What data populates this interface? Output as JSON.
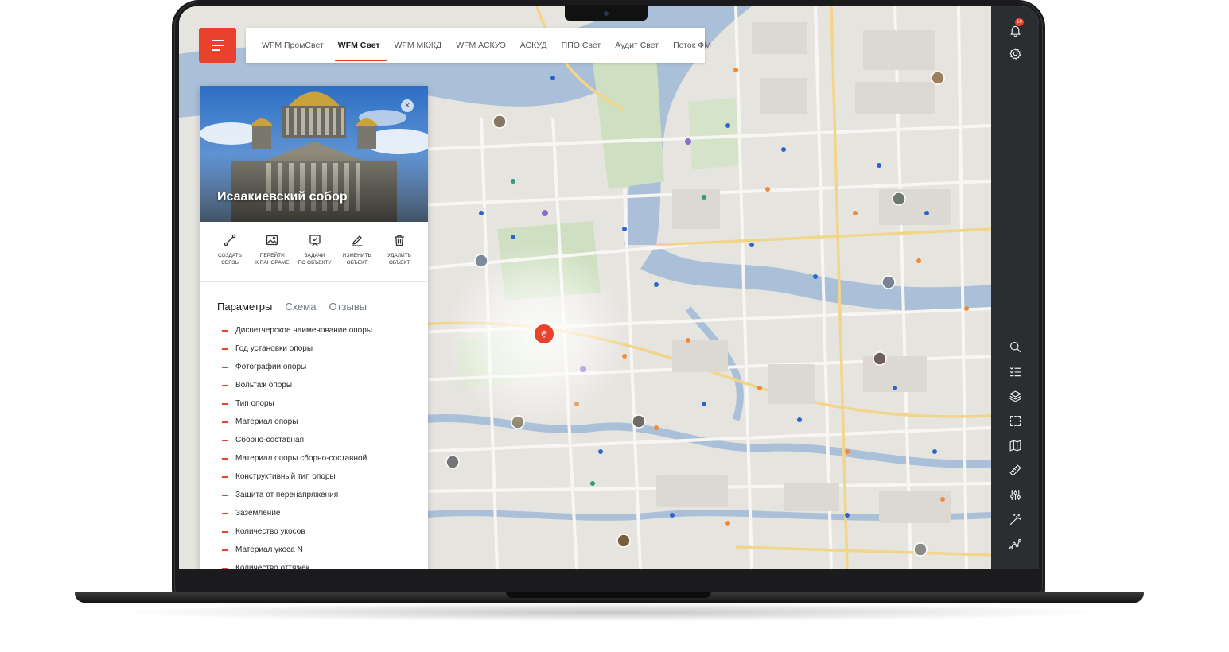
{
  "tabs": [
    {
      "label": "WFM ПромСвет",
      "active": false
    },
    {
      "label": "WFM Свет",
      "active": true
    },
    {
      "label": "WFM МКЖД",
      "active": false
    },
    {
      "label": "WFM АСКУЭ",
      "active": false
    },
    {
      "label": "АСКУД",
      "active": false
    },
    {
      "label": "ППО Свет",
      "active": false
    },
    {
      "label": "Аудит Свет",
      "active": false
    },
    {
      "label": "Поток ФМ",
      "active": false
    }
  ],
  "panel": {
    "title": "Исаакиевский собор",
    "close_icon": "×",
    "actions": [
      {
        "icon": "link-icon",
        "line1": "Создать",
        "line2": "связь"
      },
      {
        "icon": "image-icon",
        "line1": "Перейти",
        "line2": "к панораме"
      },
      {
        "icon": "task-icon",
        "line1": "Задачи",
        "line2": "по объекту"
      },
      {
        "icon": "edit-icon",
        "line1": "Изменить",
        "line2": "объект"
      },
      {
        "icon": "trash-icon",
        "line1": "Удалить",
        "line2": "объект"
      }
    ],
    "tabs": [
      {
        "label": "Параметры",
        "active": true
      },
      {
        "label": "Схема",
        "active": false
      },
      {
        "label": "Отзывы",
        "active": false
      }
    ],
    "parameters": [
      "Диспетчерское наименование опоры",
      "Год установки опоры",
      "Фотографии опоры",
      "Вольтаж опоры",
      "Тип опоры",
      "Материал опоры",
      "Сборно-составная",
      "Материал опоры сборно-составной",
      "Конструктивный тип опоры",
      "Защита от перенапряжения",
      "Заземление",
      "Количество укосов",
      "Материал укоса N",
      "Количество оттяжек"
    ]
  },
  "rail": {
    "notification_count": "10",
    "top_icons": [
      "bell-icon",
      "gear-icon"
    ],
    "tool_icons": [
      "search-icon",
      "checklist-icon",
      "layers-icon",
      "selection-icon",
      "map-icon",
      "ruler-icon",
      "filters-icon",
      "magic-wand-icon",
      "route-icon"
    ]
  },
  "colors": {
    "accent": "#e8412c",
    "rail": "#2b2e31",
    "map_background": "#e6e4df",
    "water": "#aabfd8",
    "parks": "#cfe0c2",
    "roads_major": "#f2d58a"
  }
}
